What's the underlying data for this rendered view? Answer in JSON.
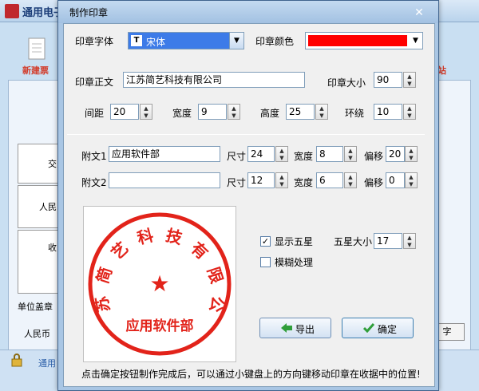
{
  "background_app": {
    "title": "通用电子",
    "left_tool_label": "新建票",
    "right_tool_label": "站",
    "table_cells": [
      "交",
      "人民",
      "收"
    ],
    "stamp_label": "单位盖章",
    "rmb_label": "人民币",
    "right_button_label": "字",
    "status_text": "通用"
  },
  "dialog": {
    "title": "制作印章",
    "close_glyph": "✕",
    "font_label": "印章字体",
    "font_value": "宋体",
    "color_label": "印章颜色",
    "color_value": "#ff0000",
    "text_label": "印章正文",
    "text_value": "江苏简艺科技有限公司",
    "size_label": "印章大小",
    "size_value": "90",
    "spacing_label": "间距",
    "spacing_value": "20",
    "width_label": "宽度",
    "width_value": "9",
    "height_label": "高度",
    "height_value": "25",
    "surround_label": "环绕",
    "surround_value": "10",
    "sub1": {
      "label": "附文1",
      "value": "应用软件部",
      "size_label": "尺寸",
      "size": "24",
      "width_label": "宽度",
      "width": "8",
      "offset_label": "偏移",
      "offset": "20"
    },
    "sub2": {
      "label": "附文2",
      "value": "",
      "size_label": "尺寸",
      "size": "12",
      "width_label": "宽度",
      "width": "6",
      "offset_label": "偏移",
      "offset": "0"
    },
    "show_star_label": "显示五星",
    "show_star_checked": true,
    "star_size_label": "五星大小",
    "star_size_value": "17",
    "blur_label": "模糊处理",
    "blur_checked": false,
    "export_button": "导出",
    "ok_button": "确定",
    "hint": "点击确定按钮制作完成后，可以通过小键盘上的方向键移动印章在收据中的位置!",
    "preview": {
      "arc_text": "江苏简艺科技有限公司",
      "bottom_text": "应用软件部",
      "star": "★"
    }
  }
}
